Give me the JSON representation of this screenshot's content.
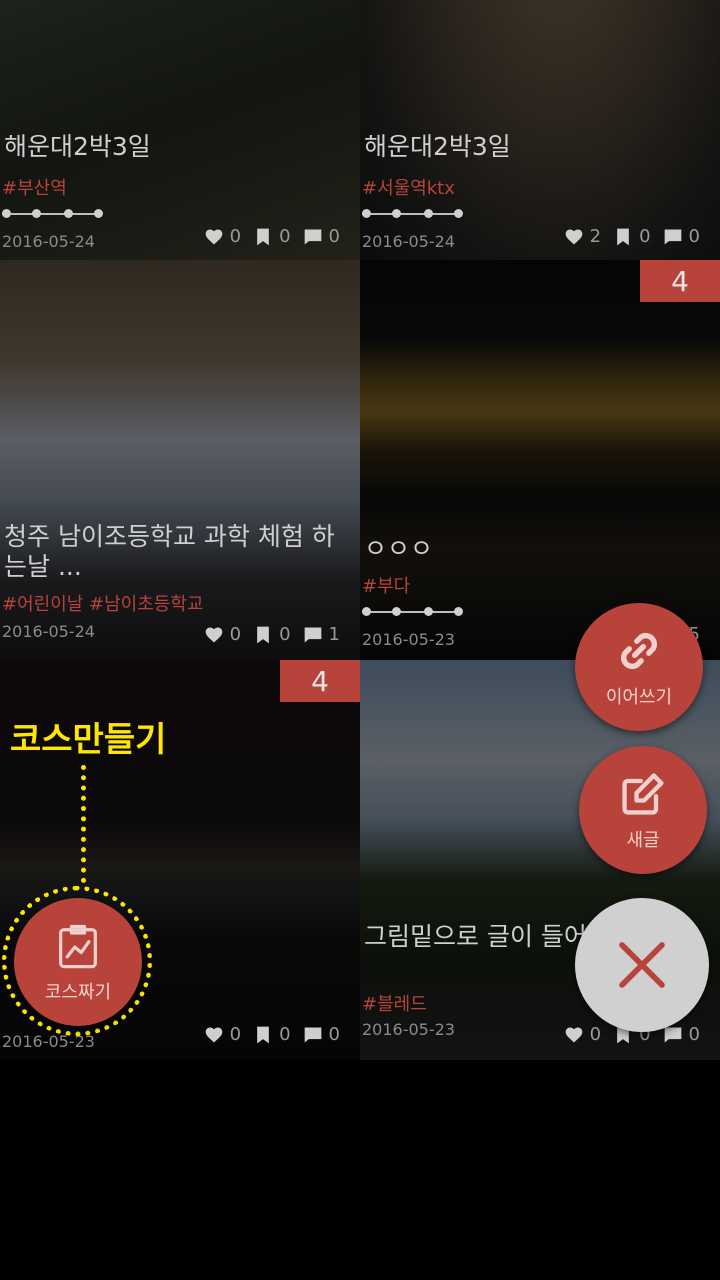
{
  "cards": [
    {
      "title": "해운대2박3일",
      "tag": "#부산역",
      "date": "2016-05-24",
      "likes": "0",
      "bookmarks": "0",
      "comments": "0",
      "badge": ""
    },
    {
      "title": "해운대2박3일",
      "tag": "#서울역ktx",
      "date": "2016-05-24",
      "likes": "2",
      "bookmarks": "0",
      "comments": "0",
      "badge": ""
    },
    {
      "title": "청주 남이조등학교 과학 체험 하는날 ...",
      "tag": "#어린이날 #남이초등학교",
      "date": "2016-05-24",
      "likes": "0",
      "bookmarks": "0",
      "comments": "1",
      "badge": ""
    },
    {
      "title": "ㅇㅇㅇ",
      "tag": "#부다",
      "date": "2016-05-23",
      "likes": "",
      "bookmarks": "",
      "comments": "5",
      "badge": "4"
    },
    {
      "title": "",
      "tag": "",
      "date": "2016-05-23",
      "likes": "0",
      "bookmarks": "0",
      "comments": "0",
      "badge": "4"
    },
    {
      "title": "그림밑으로 글이 들어 블로그...",
      "tag": "#블레드",
      "date": "2016-05-23",
      "likes": "0",
      "bookmarks": "0",
      "comments": "0",
      "badge": ""
    }
  ],
  "fabs": {
    "continue_label": "이어쓰기",
    "new_post_label": "새글",
    "course_label": "코스짜기"
  },
  "coachmark": {
    "text": "코스만들기"
  },
  "colors": {
    "accent": "#b8433a",
    "coachmark": "#ffe600",
    "close_fab": "#d0d0d0"
  }
}
